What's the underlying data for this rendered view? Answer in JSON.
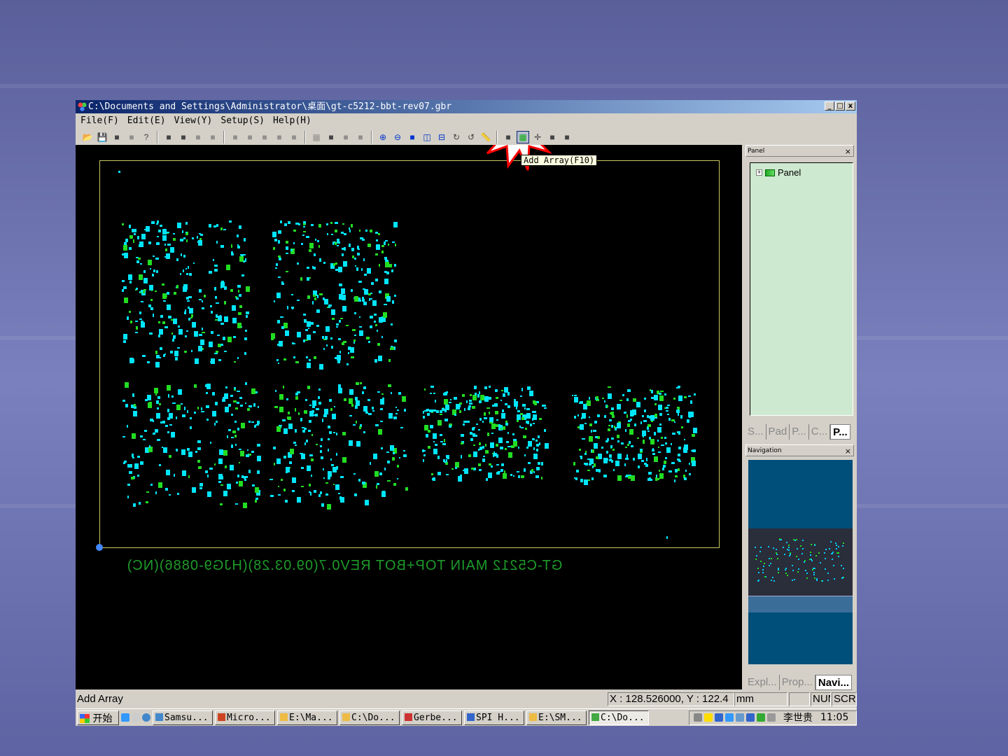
{
  "window": {
    "title": "C:\\Documents and Settings\\Administrator\\桌面\\gt-c5212-bbt-rev07.gbr",
    "min": "_",
    "max": "□",
    "close": "x"
  },
  "menu": [
    "File(F)",
    "Edit(E)",
    "View(Y)",
    "Setup(S)",
    "Help(H)"
  ],
  "toolbar": {
    "groups": [
      [
        "open-icon",
        "save-icon",
        "import-icon",
        "export-icon",
        "help-icon"
      ],
      [
        "select-icon",
        "edit-icon",
        "box-icon",
        "box2-icon"
      ],
      [
        "tool1-icon",
        "tool2-icon",
        "tool3-icon",
        "tool4-icon",
        "tool5-icon"
      ],
      [
        "grid-icon",
        "find-icon",
        "tool6-icon",
        "bom-icon"
      ],
      [
        "zoom-in-icon",
        "zoom-out-icon",
        "zoom-fit-icon",
        "split-v-icon",
        "split-h-icon",
        "rotate-icon",
        "undo-icon",
        "ruler-icon"
      ],
      [
        "camera-icon",
        "add-array-icon",
        "crosshair-icon",
        "table-icon",
        "tools-icon"
      ]
    ],
    "tooltip": "Add Array(F10)"
  },
  "board": {
    "label": "GT-C5212 MAIN TOP+BOT REV0.7(09.03.28)(HJG9-0886)(NC)"
  },
  "colors": {
    "pad": "#00e5ff",
    "pad2": "#22dd22",
    "outline": "#c8c864"
  },
  "panel": {
    "title": "Panel",
    "tree_root": "Panel",
    "expander": "+",
    "tabs": [
      "S...",
      "Pad",
      "P...",
      "C...",
      "P..."
    ],
    "active_tab": 4
  },
  "navigation": {
    "title": "Navigation",
    "tabs": [
      "Expl...",
      "Prop...",
      "Navi..."
    ],
    "active_tab": 2
  },
  "status": {
    "message": "Add Array",
    "coords": "X : 128.526000, Y : 122.4",
    "unit": "mm",
    "num": "NUM",
    "scrl": "SCRL"
  },
  "taskbar": {
    "start": "开始",
    "items": [
      "Samsu...",
      "Micro...",
      "E:\\Ma...",
      "C:\\Do...",
      "Gerbe...",
      "SPI H...",
      "E:\\SM...",
      "C:\\Do..."
    ],
    "active": 7,
    "user": "李世贵",
    "clock": "11:05"
  }
}
